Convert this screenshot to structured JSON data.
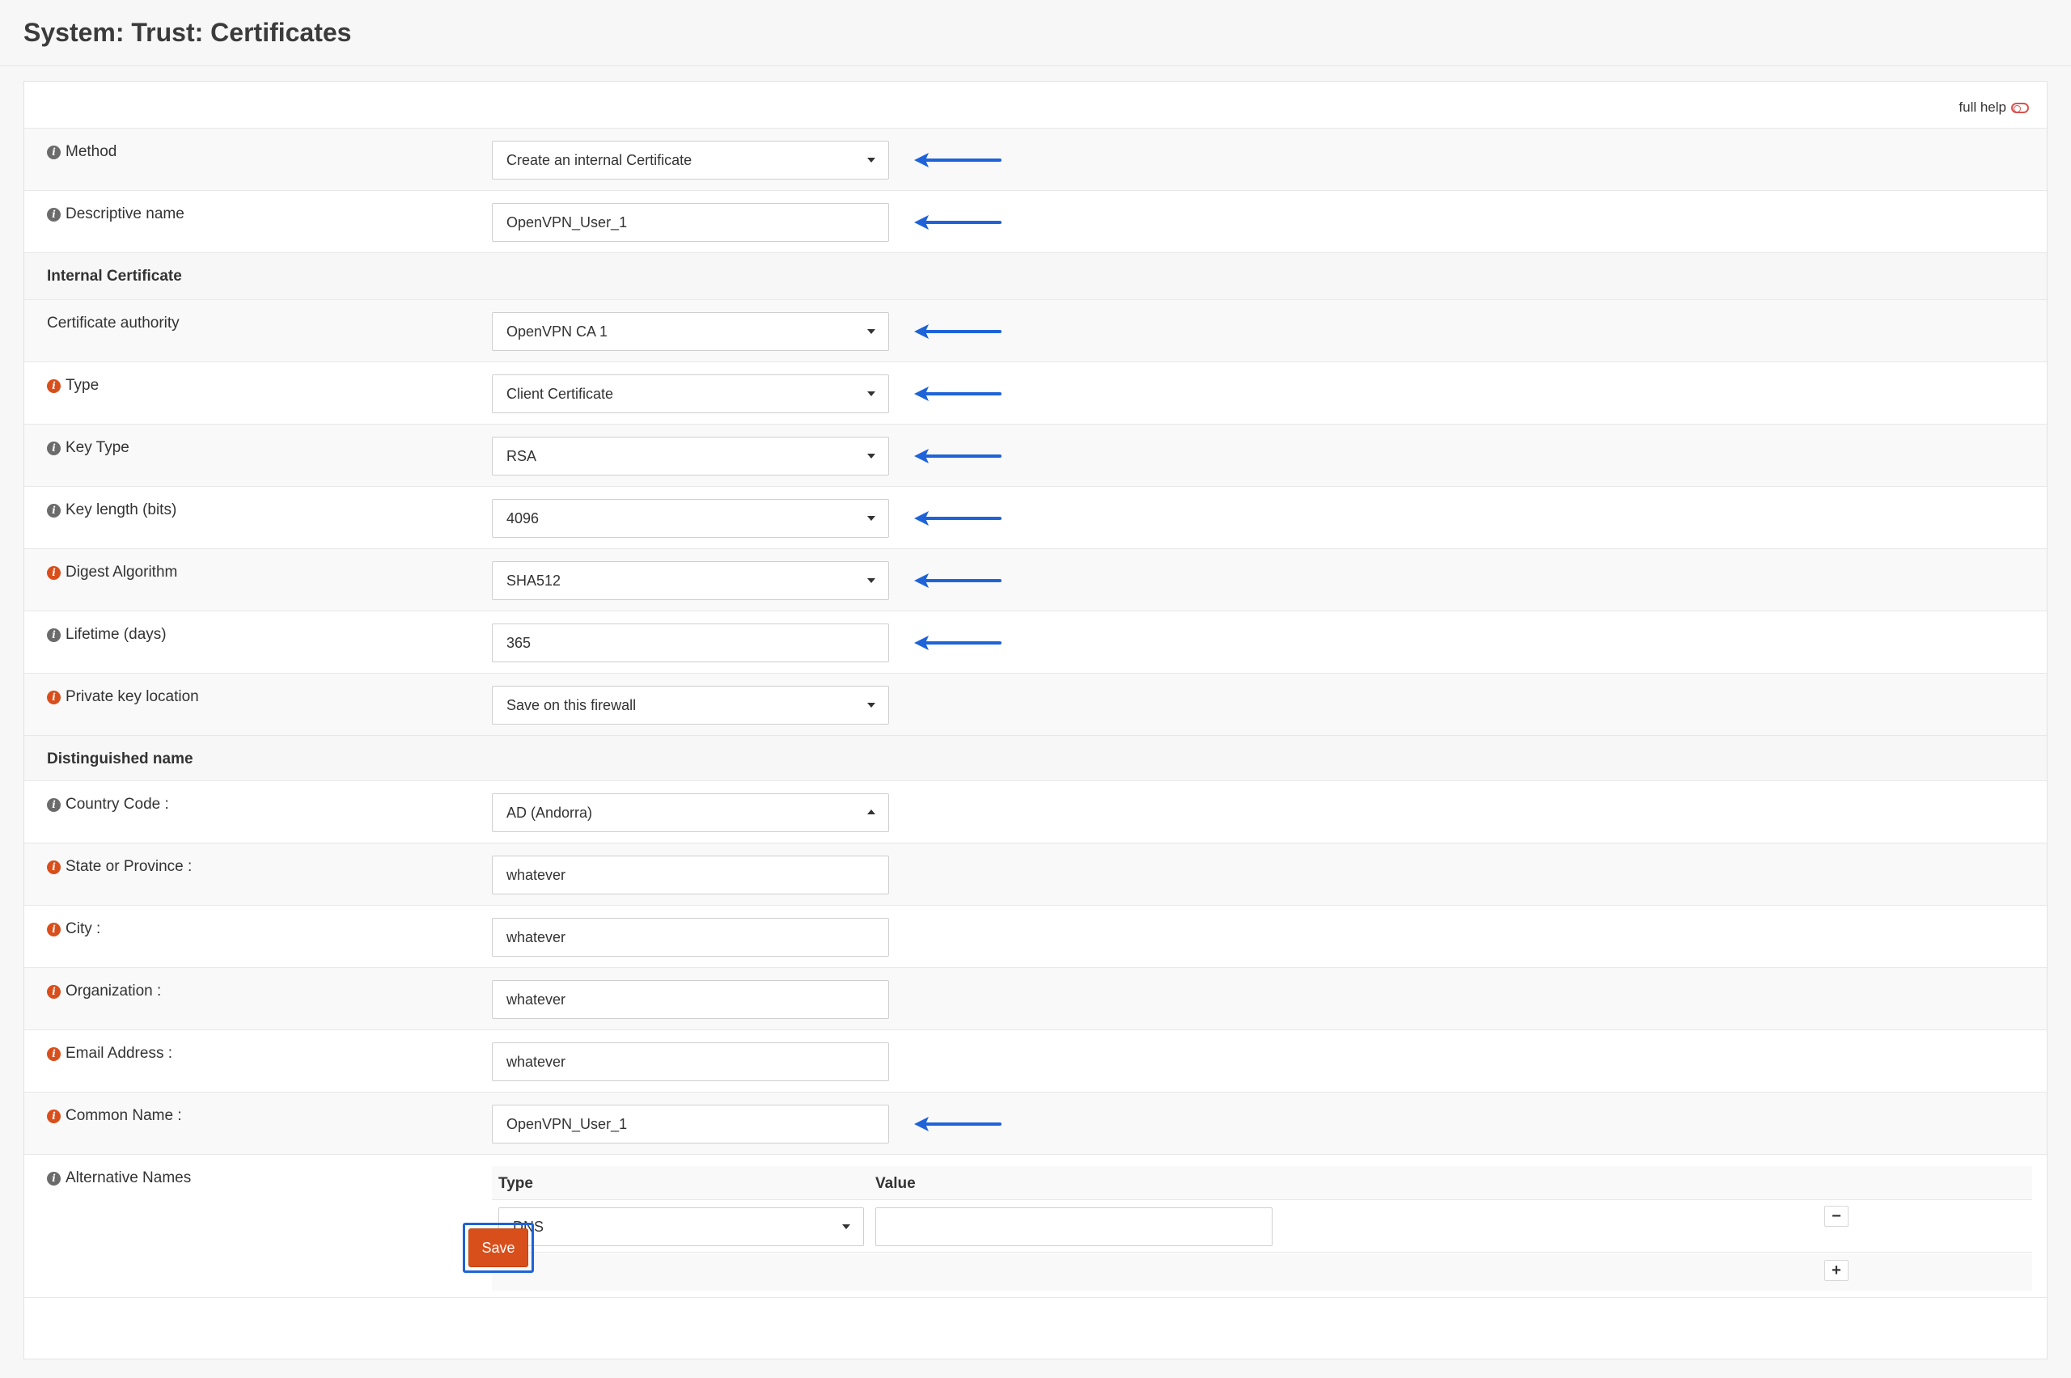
{
  "page": {
    "title": "System: Trust: Certificates"
  },
  "help": {
    "label": "full help"
  },
  "rows": {
    "method": {
      "label": "Method",
      "value": "Create an internal Certificate"
    },
    "descr": {
      "label": "Descriptive name",
      "value": "OpenVPN_User_1"
    },
    "section_internal": {
      "label": "Internal Certificate"
    },
    "ca": {
      "label": "Certificate authority",
      "value": "OpenVPN CA 1"
    },
    "type": {
      "label": "Type",
      "value": "Client Certificate"
    },
    "key_type": {
      "label": "Key Type",
      "value": "RSA"
    },
    "key_length": {
      "label": "Key length (bits)",
      "value": "4096"
    },
    "digest": {
      "label": "Digest Algorithm",
      "value": "SHA512"
    },
    "lifetime": {
      "label": "Lifetime (days)",
      "value": "365"
    },
    "key_location": {
      "label": "Private key location",
      "value": "Save on this firewall"
    },
    "section_dn": {
      "label": "Distinguished name"
    },
    "country": {
      "label": "Country Code :",
      "value": "AD (Andorra)"
    },
    "state": {
      "label": "State or Province :",
      "value": "whatever"
    },
    "city": {
      "label": "City :",
      "value": "whatever"
    },
    "org": {
      "label": "Organization :",
      "value": "whatever"
    },
    "email": {
      "label": "Email Address :",
      "value": "whatever"
    },
    "cn": {
      "label": "Common Name :",
      "value": "OpenVPN_User_1"
    },
    "altnames": {
      "label": "Alternative Names",
      "col_type": "Type",
      "col_value": "Value",
      "type_value": "DNS",
      "value_value": ""
    }
  },
  "actions": {
    "save_label": "Save",
    "remove_symbol": "−",
    "add_symbol": "+"
  },
  "colors": {
    "accent": "#d94f1c",
    "annotation_arrow": "#1e63d8",
    "save_highlight": "#1e63d8"
  },
  "icons": {
    "info_grey": "info-icon",
    "info_orange": "info-icon",
    "annotation": "left-arrow-icon",
    "help_toggle": "toggle-icon"
  }
}
